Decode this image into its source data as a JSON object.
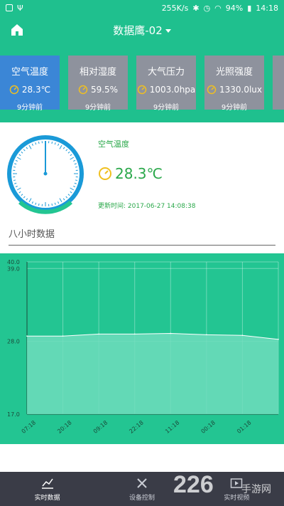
{
  "status": {
    "speed": "255K/s",
    "battery": "94%",
    "clock": "14:18"
  },
  "appbar": {
    "title": "数据鹰-02"
  },
  "cards": [
    {
      "label": "空气温度",
      "value": "28.3℃",
      "time": "9分钟前",
      "active": true
    },
    {
      "label": "相对湿度",
      "value": "59.5%",
      "time": "9分钟前",
      "active": false
    },
    {
      "label": "大气压力",
      "value": "1003.0hpa",
      "time": "9分钟前",
      "active": false
    },
    {
      "label": "光照强度",
      "value": "1330.0lux",
      "time": "9分钟前",
      "active": false
    }
  ],
  "detail": {
    "label": "空气温度",
    "value": "28.3℃",
    "updated": "更新时间: 2017-06-27 14:08:38"
  },
  "section": {
    "title": "八小时数据"
  },
  "chart_data": {
    "type": "area",
    "y_ticks": [
      "40.0",
      "39.0",
      "28.0",
      "17.0"
    ],
    "ylim": [
      17,
      40
    ],
    "x": [
      "07:18",
      "20:18",
      "09:18",
      "22:18",
      "11:18",
      "00:18",
      "01:18"
    ],
    "values": [
      28.8,
      28.8,
      29.1,
      29.1,
      29.2,
      29.0,
      28.9,
      28.3
    ],
    "colors": {
      "fill": "#6fdcbc",
      "line": "#ffffff",
      "bg": "#23c592"
    }
  },
  "nav": [
    {
      "label": "实时数据",
      "icon": "line-chart-icon",
      "active": true
    },
    {
      "label": "设备控制",
      "icon": "tools-icon",
      "active": false
    },
    {
      "label": "实时视频",
      "icon": "video-icon",
      "active": false
    }
  ],
  "watermark": {
    "number": "226",
    "text": "手游网"
  }
}
